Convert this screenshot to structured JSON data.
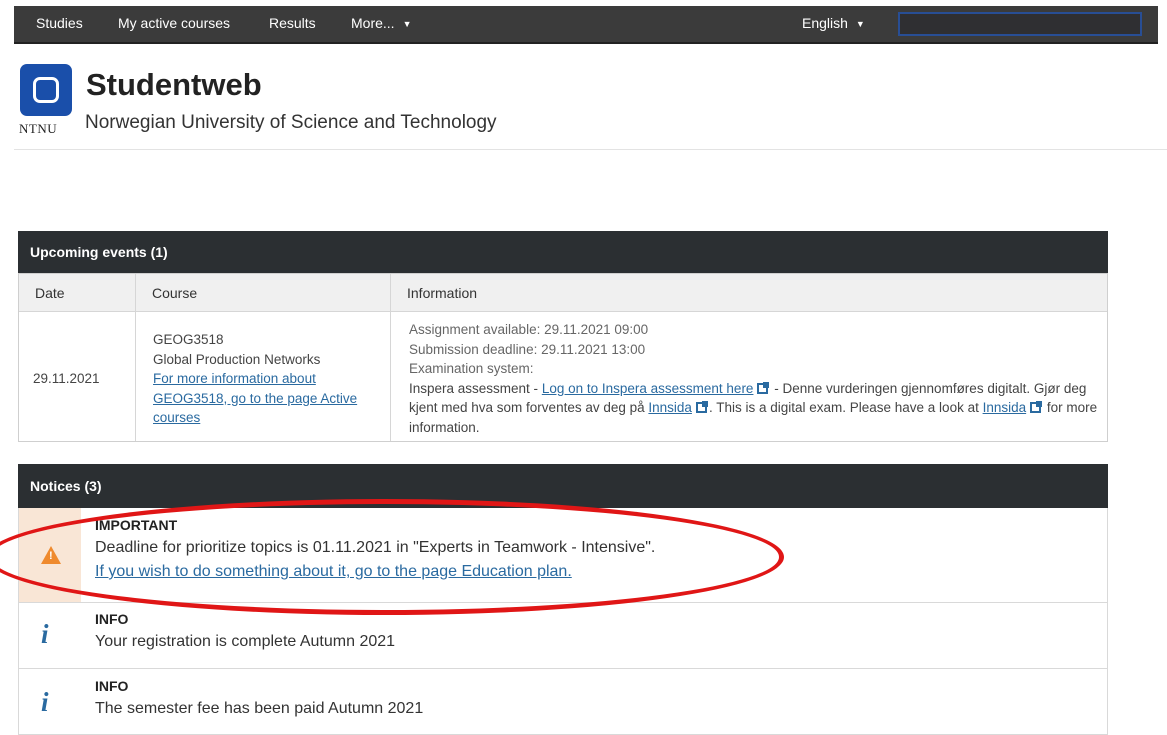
{
  "nav": {
    "studies": "Studies",
    "active_courses": "My active courses",
    "results": "Results",
    "more": "More...",
    "language": "English"
  },
  "header": {
    "logo_text": "NTNU",
    "title": "Studentweb",
    "subtitle": "Norwegian University of Science and Technology"
  },
  "events": {
    "heading": "Upcoming events (1)",
    "columns": [
      "Date",
      "Course",
      "Information"
    ],
    "row": {
      "date": "29.11.2021",
      "course_code": "GEOG3518",
      "course_name": "Global Production Networks",
      "course_link": "For more information about GEOG3518, go to the page Active courses",
      "assignment": "Assignment available: 29.11.2021 09:00",
      "deadline": "Submission deadline: 29.11.2021 13:00",
      "exam_system": "Examination system:",
      "inspera_prefix": "Inspera assessment - ",
      "inspera_link": "Log on to Inspera assessment here",
      "text_a": " - Denne vurderingen gjennomføres digitalt. Gjør deg kjent med hva som forventes av deg på ",
      "innsida_link_1": "Innsida",
      "text_b": ". This is a digital exam. Please have a look at ",
      "innsida_link_2": "Innsida",
      "text_c": " for more information."
    }
  },
  "notices": {
    "heading": "Notices (3)",
    "items": [
      {
        "type": "IMPORTANT",
        "text": "Deadline for prioritize topics is 01.11.2021 in \"Experts in Teamwork - Intensive\".",
        "link": "If you wish to do something about it, go to the page Education plan."
      },
      {
        "type": "INFO",
        "text": "Your registration is complete Autumn 2021"
      },
      {
        "type": "INFO",
        "text": "The semester fee has been paid Autumn 2021"
      }
    ]
  },
  "colors": {
    "navbar": "#3b3b3b",
    "brand_blue": "#1a4faa",
    "link": "#2a6aa0",
    "warning": "#ef8a2e",
    "highlight_oval": "#e01616"
  }
}
